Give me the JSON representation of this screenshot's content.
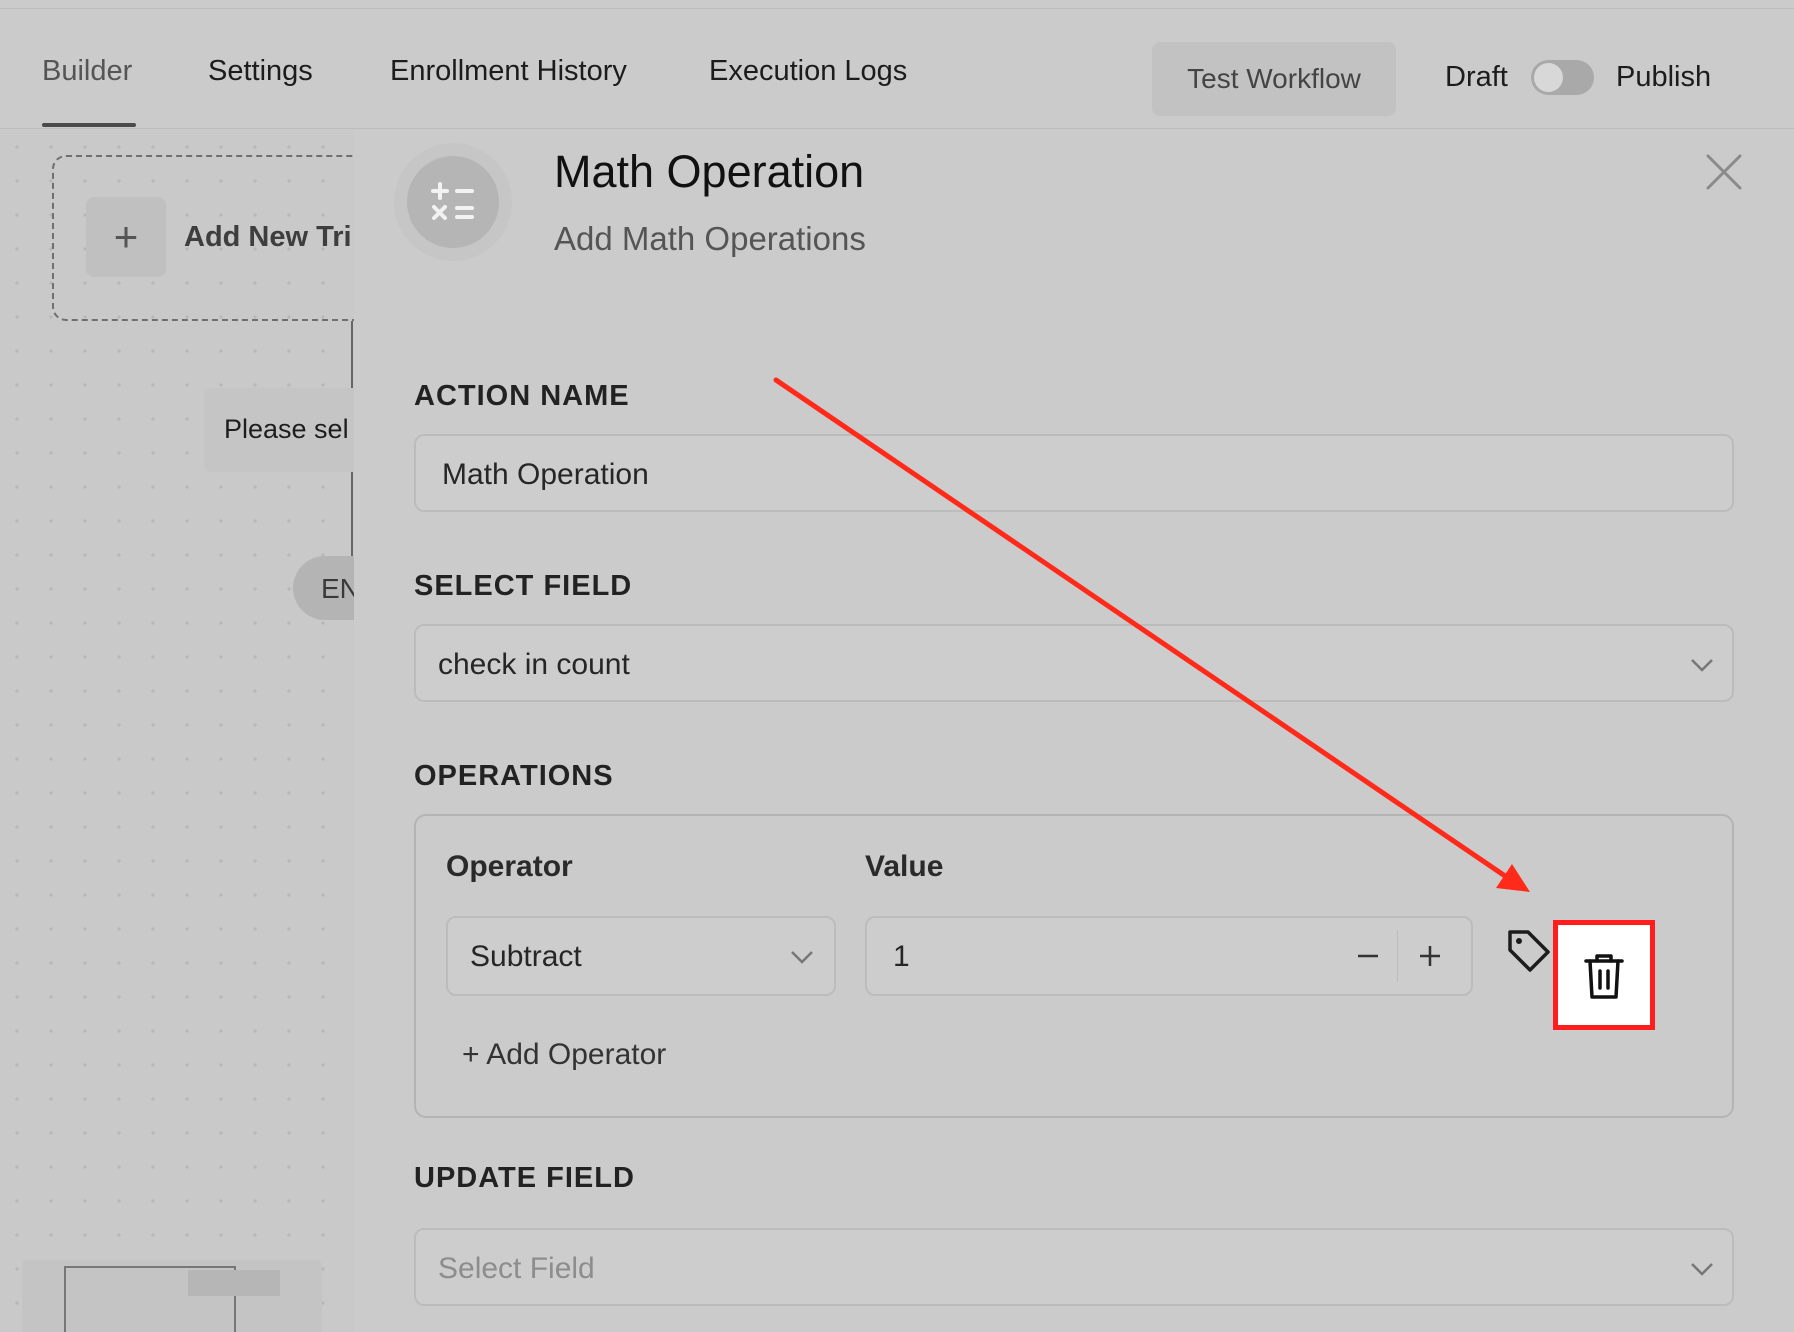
{
  "tabs": [
    {
      "label": "Builder",
      "active": true
    },
    {
      "label": "Settings",
      "active": false
    },
    {
      "label": "Enrollment History",
      "active": false
    },
    {
      "label": "Execution Logs",
      "active": false
    }
  ],
  "header": {
    "test_button_label": "Test Workflow",
    "draft_label": "Draft",
    "publish_label": "Publish",
    "published": false
  },
  "canvas": {
    "add_trigger_icon": "+",
    "add_trigger_label": "Add New Tri",
    "select_hint": "Please sel",
    "end_label": "EN"
  },
  "panel": {
    "icon": "calculator-icon",
    "title": "Math Operation",
    "subtitle": "Add Math Operations",
    "action_name": {
      "label": "ACTION NAME",
      "value": "Math Operation"
    },
    "select_field": {
      "label": "SELECT FIELD",
      "value": "check in count"
    },
    "operations": {
      "label": "OPERATIONS",
      "operator_header": "Operator",
      "value_header": "Value",
      "rows": [
        {
          "operator": "Subtract",
          "value": "1"
        }
      ],
      "add_label": "+ Add Operator"
    },
    "update_field": {
      "label": "UPDATE FIELD",
      "placeholder": "Select Field"
    }
  },
  "colors": {
    "annotation": "#ff1d1d",
    "background": "#cbcbcb"
  }
}
